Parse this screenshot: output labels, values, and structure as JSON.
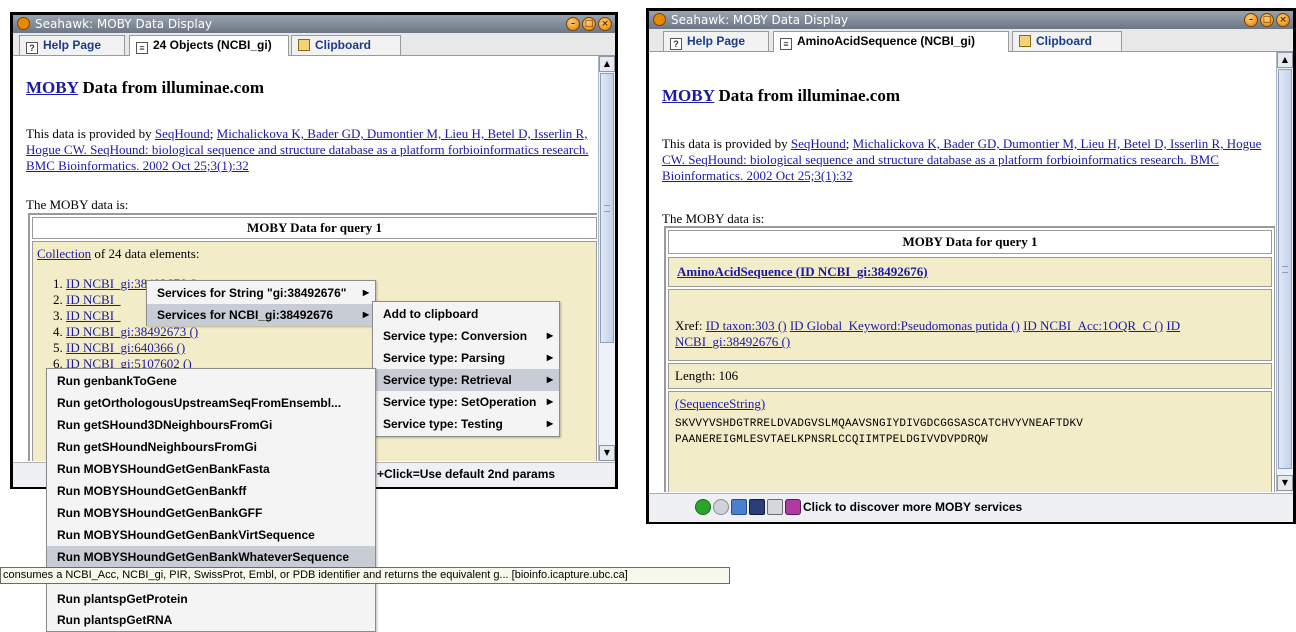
{
  "left_window": {
    "title": "Seahawk: MOBY Data Display",
    "tabs": [
      {
        "label": "Help Page",
        "icon": "help-icon"
      },
      {
        "label": "24 Objects (NCBI_gi)",
        "icon": "document-icon"
      },
      {
        "label": "Clipboard",
        "icon": "clipboard-icon"
      }
    ],
    "heading_link": "MOBY",
    "heading_text": " Data from illuminae.com",
    "provided_prefix": "This data is provided by ",
    "provider_link": "SeqHound",
    "citation": "Michalickova K, Bader GD, Dumontier M, Lieu H, Betel D, Isserlin R, Hogue CW. SeqHound: biological sequence and structure database as a platform forbioinformatics research. BMC Bioinformatics. 2002 Oct 25;3(1):32",
    "data_is": "The MOBY data is:",
    "table_header": "MOBY Data for query 1",
    "collection_link": "Collection",
    "collection_text": " of 24 data elements:",
    "list_items": [
      "ID NCBI_gi:38492676 ()",
      "ID NCBI_",
      "ID NCBI_",
      "ID NCBI_gi:38492673 ()",
      "ID NCBI_gi:640366 ()",
      "ID NCBI_gi:5107602 ()"
    ],
    "status_text": "trl+Click=Use default 2nd params"
  },
  "context_menu_1": {
    "items": [
      {
        "label": "Services for String \"gi:38492676\""
      },
      {
        "label": "Services for NCBI_gi:38492676"
      }
    ]
  },
  "context_menu_2": {
    "items": [
      {
        "label": "Add to clipboard"
      },
      {
        "label": "Service type: Conversion"
      },
      {
        "label": "Service type: Parsing"
      },
      {
        "label": "Service type: Retrieval"
      },
      {
        "label": "Service type: SetOperation"
      },
      {
        "label": "Service type: Testing"
      }
    ]
  },
  "retrieval_menu": {
    "items": [
      "Run genbankToGene",
      "Run getOrthologousUpstreamSeqFromEnsembl...",
      "Run getSHound3DNeighboursFromGi",
      "Run getSHoundNeighboursFromGi",
      "Run MOBYSHoundGetGenBankFasta",
      "Run MOBYSHoundGetGenBankff",
      "Run MOBYSHoundGetGenBankGFF",
      "Run MOBYSHoundGetGenBankVirtSequence",
      "Run MOBYSHoundGetGenBankWhateverSequence",
      "Run plantspGetProtein",
      "Run plantspGetRNA"
    ],
    "tooltip": "consumes a NCBI_Acc, NCBI_gi, PIR, SwissProt, Embl, or PDB identifier and returns the equivalent g... [bioinfo.icapture.ubc.ca]"
  },
  "right_window": {
    "title": "Seahawk: MOBY Data Display",
    "tabs": [
      {
        "label": "Help Page",
        "icon": "help-icon"
      },
      {
        "label": "AminoAcidSequence (NCBI_gi)",
        "icon": "document-icon"
      },
      {
        "label": "Clipboard",
        "icon": "clipboard-icon"
      }
    ],
    "heading_link": "MOBY",
    "heading_text": " Data from illuminae.com",
    "provided_prefix": "This data is provided by ",
    "provider_link": "SeqHound",
    "citation": "Michalickova K, Bader GD, Dumontier M, Lieu H, Betel D, Isserlin R, Hogue CW. SeqHound: biological sequence and structure database as a platform forbioinformatics research. BMC Bioinformatics. 2002 Oct 25;3(1):32",
    "data_is": "The MOBY data is:",
    "table_header": "MOBY Data for query 1",
    "sequence_title": "AminoAcidSequence (ID NCBI_gi:38492676)",
    "xref_label": "Xref: ",
    "xrefs": [
      "ID taxon:303 ()",
      "ID Global_Keyword:Pseudomonas putida ()",
      "ID NCBI_Acc:1OQR_C ()",
      "ID NCBI_gi:38492676 ()"
    ],
    "length_text": "Length: 106",
    "seqstring_link": "(SequenceString)",
    "seq_line1": "SKVVYVSHDGTRRELDVADGVSLMQAAVSNGIYDIVGDCGGSASCATCHVYVNEAFTDKV",
    "seq_line2": "PAANEREIGMLESVTAELKPNSRLCCQIIMTPELDGIVVDVPDRQW",
    "status_text": "Click to discover more MOBY services"
  },
  "colors": {
    "data_cell": "#f2ecc8",
    "link": "#1a1aa6",
    "titlebar": "#7a8494"
  }
}
